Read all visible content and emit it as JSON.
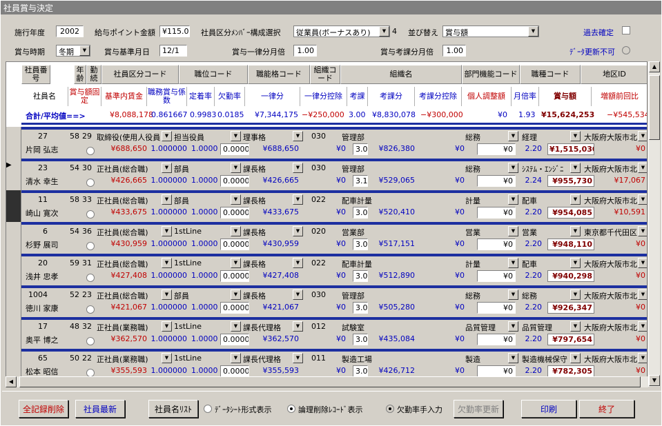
{
  "window": {
    "title": "社員賞与決定"
  },
  "header": {
    "year_label": "施行年度",
    "year": "2002",
    "point_label": "給与ポイント金額",
    "point": "¥115.0",
    "member_label": "社員区分ﾒﾝﾊﾞｰ構成選択",
    "member": "従業員(ボーナスあり)",
    "member_num": "4",
    "sort_label": "並び替え",
    "sort": "賞与額",
    "past_label": "過去確定",
    "period_label": "賞与時期",
    "period": "冬期",
    "base_date_label": "賞与基準月日",
    "base_date": "12/1",
    "uniform_label": "賞与一律分月倍",
    "uniform": "1.00",
    "eval_label": "賞与考課分月倍",
    "eval": "1.00",
    "no_update_label": "ﾃﾞｰﾀ更新不可"
  },
  "columns": {
    "r1": [
      "社員番号",
      "年齢",
      "勤続",
      "社員区分コード",
      "職位コード",
      "職能格コード",
      "組織コード",
      "組織名",
      "部門機能コード",
      "職種コード",
      "地区ID"
    ],
    "r2": [
      "社員名",
      "賞与額固定",
      "基準内賃金",
      "職務賞与係数",
      "定着率",
      "欠勤率",
      "一律分",
      "一律分控除",
      "考課",
      "考課分",
      "考課分控除",
      "個人調整額",
      "月倍率",
      "賞与額",
      "増額前回比"
    ]
  },
  "totals": {
    "label": "合計/平均値==>",
    "base": "¥8,088,178",
    "coef": "0.861667",
    "retention": "0.9983",
    "absence": "0.0185",
    "uniform": "¥7,344,175",
    "uniform_ded": "−¥250,000",
    "eval": "3.00",
    "eval_amt": "¥8,830,078",
    "eval_ded": "−¥300,000",
    "adj": "¥0",
    "mult": "1.93",
    "bonus": "¥15,624,253",
    "prev": "−¥545,534"
  },
  "records": [
    {
      "no": "27",
      "age": "58",
      "tenure": "29",
      "class": "取締役(使用人役員",
      "position": "担当役員",
      "grade": "理事格",
      "org_code": "030",
      "org": "管理部",
      "dept": "総務",
      "job": "経理",
      "area": "大阪府大阪市北",
      "name": "片岡 弘志",
      "base": "¥688,650",
      "coef": "1.000000",
      "ret": "1.0000",
      "abs": "0.0000",
      "uni": "¥688,650",
      "uni_ded": "¥0",
      "eval": "3.0",
      "eval_amt": "¥826,380",
      "eval_ded": "¥0",
      "adj": "¥0",
      "mult": "2.20",
      "bonus": "¥1,515,030",
      "prev": "¥0"
    },
    {
      "no": "23",
      "age": "54",
      "tenure": "30",
      "class": "正社員(総合職)",
      "position": "部員",
      "grade": "課長格",
      "org_code": "030",
      "org": "管理部",
      "dept": "総務",
      "job": "ｼｽﾃﾑ・ｴﾝｼﾞﾆ",
      "area": "大阪府大阪市北",
      "name": "清水 幸生",
      "base": "¥426,665",
      "coef": "1.000000",
      "ret": "1.0000",
      "abs": "0.0000",
      "uni": "¥426,665",
      "uni_ded": "¥0",
      "eval": "3.1",
      "eval_amt": "¥529,065",
      "eval_ded": "¥0",
      "adj": "¥0",
      "mult": "2.24",
      "bonus": "¥955,730",
      "prev": "¥17,067"
    },
    {
      "no": "11",
      "age": "58",
      "tenure": "33",
      "class": "正社員(総合職)",
      "position": "部員",
      "grade": "課長格",
      "org_code": "022",
      "org": "配車計量",
      "dept": "計量",
      "job": "配車",
      "area": "大阪府大阪市北",
      "name": "崎山 寛次",
      "base": "¥433,675",
      "coef": "1.000000",
      "ret": "1.0000",
      "abs": "0.0000",
      "uni": "¥433,675",
      "uni_ded": "¥0",
      "eval": "3.0",
      "eval_amt": "¥520,410",
      "eval_ded": "¥0",
      "adj": "¥0",
      "mult": "2.20",
      "bonus": "¥954,085",
      "prev": "¥10,591"
    },
    {
      "no": "6",
      "age": "54",
      "tenure": "36",
      "class": "正社員(総合職)",
      "position": "1stLine",
      "grade": "課長格",
      "org_code": "020",
      "org": "営業部",
      "dept": "営業",
      "job": "営業",
      "area": "東京都千代田区",
      "name": "杉野 展司",
      "base": "¥430,959",
      "coef": "1.000000",
      "ret": "1.0000",
      "abs": "0.0000",
      "uni": "¥430,959",
      "uni_ded": "¥0",
      "eval": "3.0",
      "eval_amt": "¥517,151",
      "eval_ded": "¥0",
      "adj": "¥0",
      "mult": "2.20",
      "bonus": "¥948,110",
      "prev": "¥0"
    },
    {
      "no": "20",
      "age": "59",
      "tenure": "31",
      "class": "正社員(総合職)",
      "position": "1stLine",
      "grade": "課長格",
      "org_code": "022",
      "org": "配車計量",
      "dept": "計量",
      "job": "配車",
      "area": "大阪府大阪市北",
      "name": "浅井 忠孝",
      "base": "¥427,408",
      "coef": "1.000000",
      "ret": "1.0000",
      "abs": "0.0000",
      "uni": "¥427,408",
      "uni_ded": "¥0",
      "eval": "3.0",
      "eval_amt": "¥512,890",
      "eval_ded": "¥0",
      "adj": "¥0",
      "mult": "2.20",
      "bonus": "¥940,298",
      "prev": "¥0"
    },
    {
      "no": "1004",
      "age": "52",
      "tenure": "23",
      "class": "正社員(総合職)",
      "position": "部員",
      "grade": "課長格",
      "org_code": "030",
      "org": "管理部",
      "dept": "総務",
      "job": "総務",
      "area": "大阪府大阪市北",
      "name": "徳川 家康",
      "base": "¥421,067",
      "coef": "1.000000",
      "ret": "1.0000",
      "abs": "0.0000",
      "uni": "¥421,067",
      "uni_ded": "¥0",
      "eval": "3.0",
      "eval_amt": "¥505,280",
      "eval_ded": "¥0",
      "adj": "¥0",
      "mult": "2.20",
      "bonus": "¥926,347",
      "prev": "¥0"
    },
    {
      "no": "17",
      "age": "48",
      "tenure": "32",
      "class": "正社員(業務職)",
      "position": "1stLine",
      "grade": "課長代理格",
      "org_code": "012",
      "org": "試験室",
      "dept": "品質管理",
      "job": "品質管理",
      "area": "大阪府大阪市北",
      "name": "奥平 博之",
      "base": "¥362,570",
      "coef": "1.000000",
      "ret": "1.0000",
      "abs": "0.0000",
      "uni": "¥362,570",
      "uni_ded": "¥0",
      "eval": "3.0",
      "eval_amt": "¥435,084",
      "eval_ded": "¥0",
      "adj": "¥0",
      "mult": "2.20",
      "bonus": "¥797,654",
      "prev": "¥0"
    },
    {
      "no": "65",
      "age": "50",
      "tenure": "22",
      "class": "正社員(業務職)",
      "position": "1stLine",
      "grade": "課長代理格",
      "org_code": "011",
      "org": "製造工場",
      "dept": "製造",
      "job": "製造機械保守",
      "area": "大阪府大阪市北",
      "name": "松本 昭信",
      "base": "¥355,593",
      "coef": "1.000000",
      "ret": "1.0000",
      "abs": "0.0000",
      "uni": "¥355,593",
      "uni_ded": "¥0",
      "eval": "3.0",
      "eval_amt": "¥426,712",
      "eval_ded": "¥0",
      "adj": "¥0",
      "mult": "2.20",
      "bonus": "¥782,305",
      "prev": "¥0"
    }
  ],
  "footer": {
    "delete_all": "全記録削除",
    "refresh": "社員最新",
    "name_list": "社員名ﾘｽﾄ",
    "opt_sheet": "ﾃﾞｰﾀｼｰﾄ形式表示",
    "opt_logical": "論理削除ﾚｺｰﾄﾞ表示",
    "opt_absence": "欠勤率手入力",
    "absence_update": "欠勤率更新",
    "print": "印刷",
    "exit": "終了"
  }
}
